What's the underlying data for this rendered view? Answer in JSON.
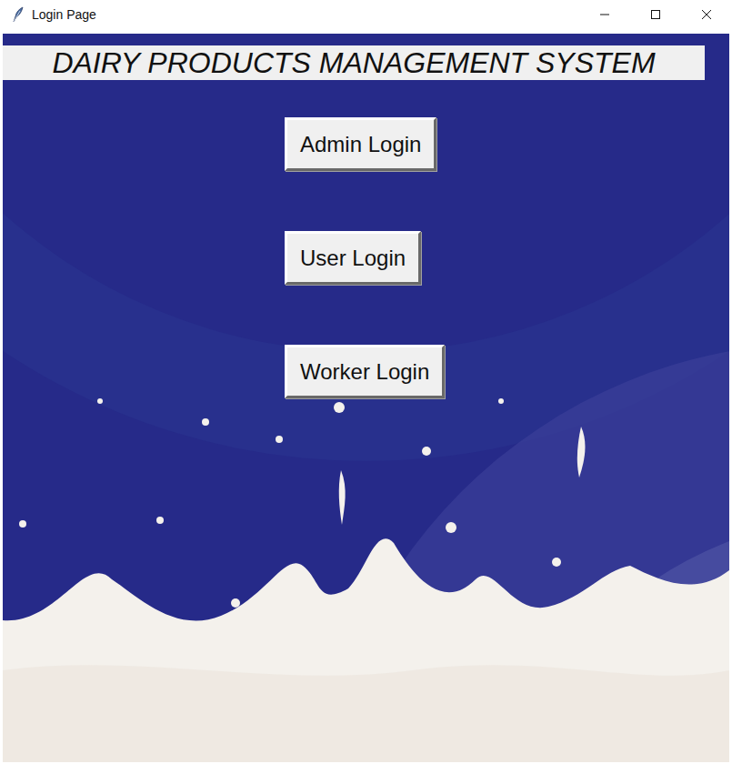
{
  "window": {
    "title": "Login Page"
  },
  "header": {
    "title": "DAIRY PRODUCTS MANAGEMENT SYSTEM"
  },
  "buttons": [
    {
      "label": "Admin Login"
    },
    {
      "label": "User Login"
    },
    {
      "label": "Worker Login"
    }
  ]
}
